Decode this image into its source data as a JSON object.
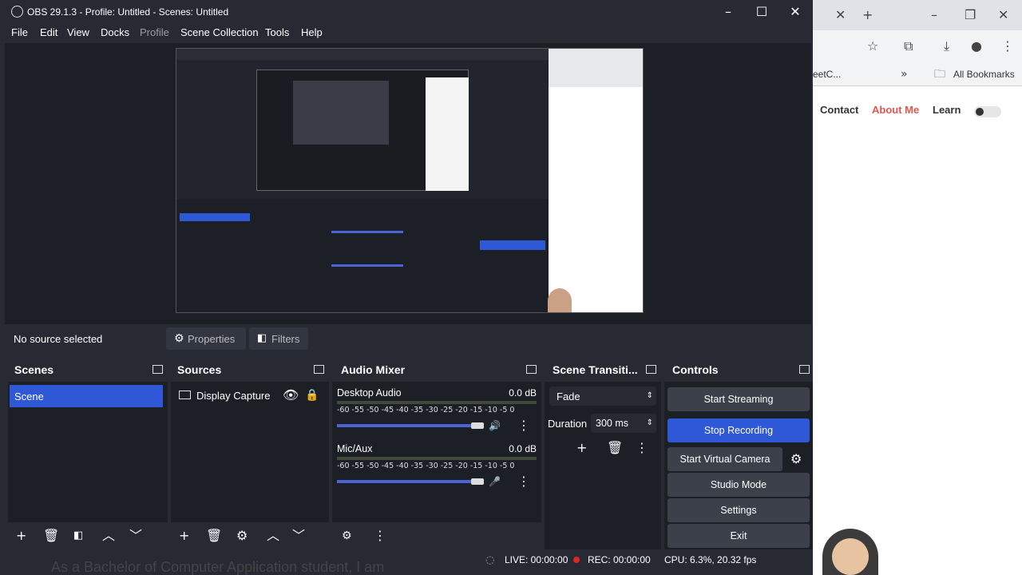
{
  "window": {
    "title": "OBS 29.1.3 - Profile: Untitled - Scenes: Untitled"
  },
  "menu": [
    "File",
    "Edit",
    "View",
    "Docks",
    "Profile",
    "Scene Collection",
    "Tools",
    "Help"
  ],
  "source_bar": {
    "status": "No source selected",
    "properties": "Properties",
    "filters": "Filters"
  },
  "scenes": {
    "title": "Scenes",
    "items": [
      "Scene"
    ]
  },
  "sources": {
    "title": "Sources",
    "items": [
      "Display Capture"
    ]
  },
  "audio_mixer": {
    "title": "Audio Mixer",
    "channels": [
      {
        "name": "Desktop Audio",
        "db": "0.0 dB",
        "level": 0.9
      },
      {
        "name": "Mic/Aux",
        "db": "0.0 dB",
        "level": 0.9
      }
    ],
    "scale": "-60 -55 -50 -45 -40 -35 -30 -25 -20 -15 -10 -5 0"
  },
  "transitions": {
    "title": "Scene Transiti...",
    "type": "Fade",
    "duration_label": "Duration",
    "duration_value": "300 ms"
  },
  "controls": {
    "title": "Controls",
    "buttons": [
      "Start Streaming",
      "Stop Recording",
      "Start Virtual Camera",
      "Studio Mode",
      "Settings",
      "Exit"
    ]
  },
  "status": {
    "live": "LIVE: 00:00:00",
    "rec": "REC: 00:00:00",
    "cpu": "CPU: 6.3%, 20.32 fps"
  },
  "browser": {
    "tab_text": "eetC...",
    "bookmarks_label": "All Bookmarks",
    "nav": [
      "Contact",
      "About Me",
      "Learn"
    ],
    "body_text": "As a Bachelor of Computer Application student, I am"
  },
  "colors": {
    "accent": "#2f58d6",
    "about_me": "#e0574f",
    "rec_dot": "#e02424"
  }
}
